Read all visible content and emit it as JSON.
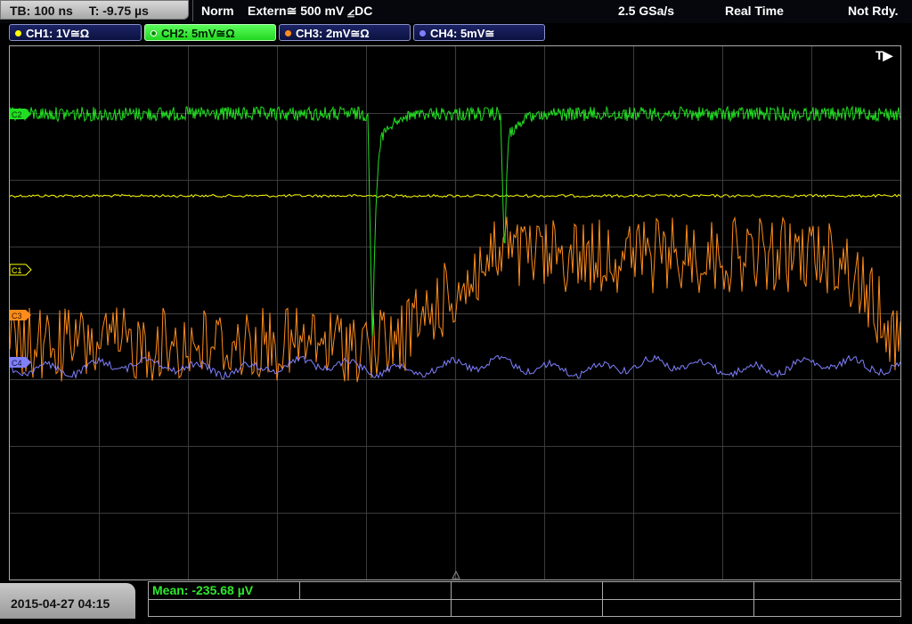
{
  "header": {
    "timebase": "TB: 100 ns",
    "trigger_time": "T: -9.75 µs",
    "trigger_mode": "Norm",
    "trigger_source": "Extern≅ 500 mV ⦤DC",
    "sample_rate": "2.5 GSa/s",
    "acq_mode": "Real Time",
    "status": "Not Rdy."
  },
  "channels": [
    {
      "label": "CH1: 1V≅Ω",
      "color": "#ffff00"
    },
    {
      "label": "CH2: 5mV≅Ω",
      "color": "#22dd22"
    },
    {
      "label": "CH3: 2mV≅Ω",
      "color": "#ff8c1a"
    },
    {
      "label": "CH4: 5mV≅",
      "color": "#8080ff"
    }
  ],
  "markers": {
    "ch1": "C1",
    "ch2": "C2",
    "ch3": "C3",
    "ch4": "C4",
    "trigger": "T▶"
  },
  "footer": {
    "datetime": "2015-04-27 04:15",
    "measurement": "Mean: -235.68 µV"
  },
  "colors": {
    "ch1": "#ffff00",
    "ch2": "#22dd22",
    "ch3": "#ff8c1a",
    "ch4": "#8080ff",
    "grid": "#3a3a3a"
  }
}
